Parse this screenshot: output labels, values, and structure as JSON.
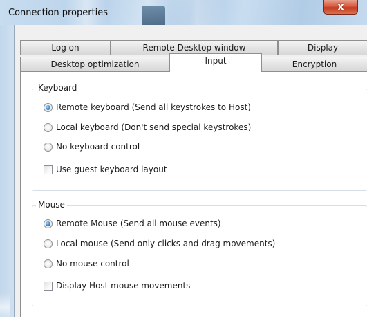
{
  "window": {
    "title": "Connection properties",
    "close_glyph": "x"
  },
  "tabs": {
    "row1": [
      "Log on",
      "Remote Desktop window",
      "Display"
    ],
    "row2": [
      "Desktop optimization",
      "Input",
      "Encryption"
    ],
    "active": "Input"
  },
  "keyboard": {
    "title": "Keyboard",
    "options": [
      {
        "label": "Remote keyboard (Send all keystrokes to Host)",
        "selected": true
      },
      {
        "label": "Local keyboard (Don't send special keystrokes)",
        "selected": false
      },
      {
        "label": "No keyboard control",
        "selected": false
      }
    ],
    "guest_layout": {
      "label": "Use guest keyboard layout",
      "checked": false
    }
  },
  "mouse": {
    "title": "Mouse",
    "options": [
      {
        "label": "Remote Mouse (Send all mouse events)",
        "selected": true
      },
      {
        "label": "Local mouse (Send only clicks and drag movements)",
        "selected": false
      },
      {
        "label": "No mouse control",
        "selected": false
      }
    ],
    "display_host": {
      "label": "Display Host mouse movements",
      "checked": false
    }
  },
  "colors": {
    "title_bar": "#c7dcef",
    "close_button": "#c94a2c",
    "selected_radio": "#2f78c4"
  }
}
